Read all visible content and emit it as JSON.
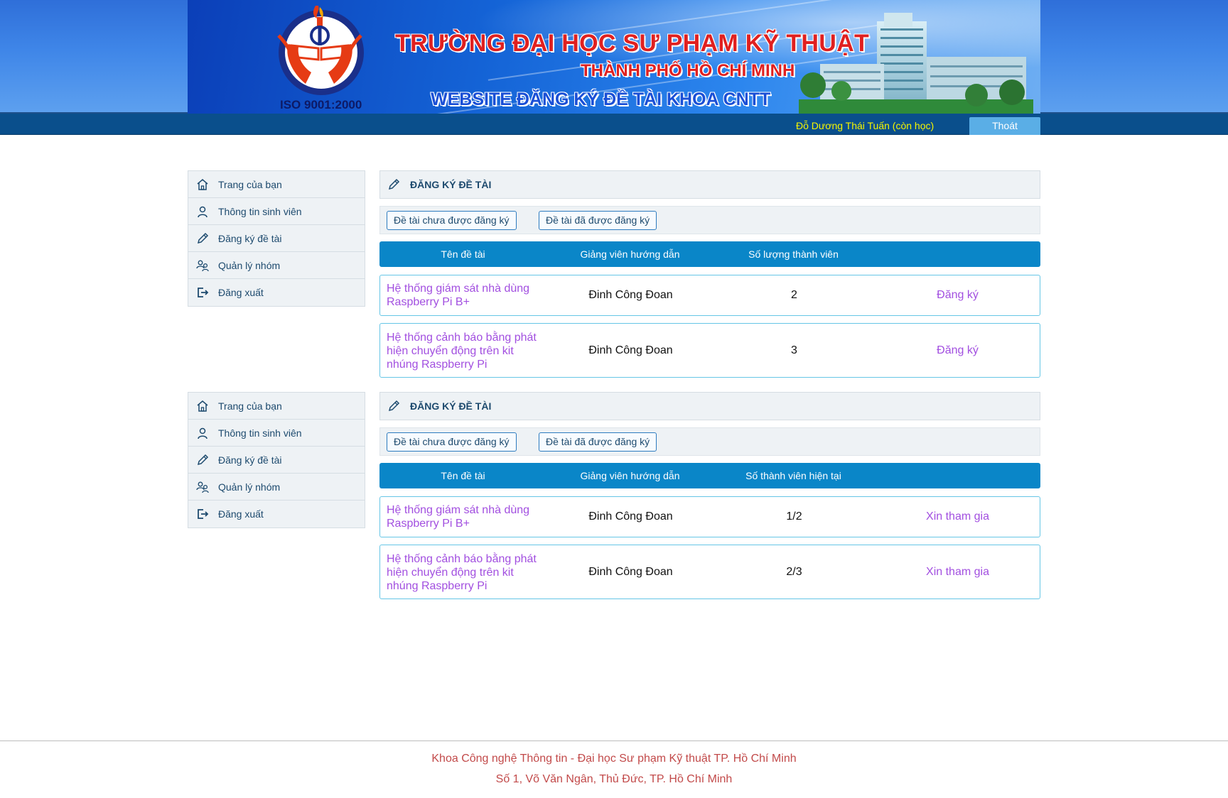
{
  "header": {
    "title_line1": "TRƯỜNG ĐẠI HỌC SƯ PHẠM KỸ THUẬT",
    "title_line2": "THÀNH PHỐ HỒ CHÍ MINH",
    "title_line3": "WEBSITE ĐĂNG KÝ ĐỀ TÀI KHOA CNTT",
    "iso": "ISO 9001:2000",
    "user_name": "Đỗ Dương Thái Tuấn (còn học)",
    "logout_label": "Thoát"
  },
  "sidebar": {
    "items": [
      {
        "label": "Trang của bạn",
        "icon": "home-icon"
      },
      {
        "label": "Thông tin sinh viên",
        "icon": "user-icon"
      },
      {
        "label": "Đăng ký đề tài",
        "icon": "pencil-icon"
      },
      {
        "label": "Quản lý nhóm",
        "icon": "users-icon"
      },
      {
        "label": "Đăng xuất",
        "icon": "logout-icon"
      }
    ]
  },
  "panels": [
    {
      "title": "ĐĂNG KÝ ĐỀ TÀI",
      "tabs": [
        "Đề tài chưa được đăng ký",
        "Đề tài đã được đăng ký"
      ],
      "columns": [
        "Tên đề tài",
        "Giảng viên hướng dẫn",
        "Số lượng thành viên"
      ],
      "rows": [
        {
          "topic": "Hệ thống giám sát nhà dùng Raspberry Pi B+",
          "lecturer": "Đinh Công Đoan",
          "members": "2",
          "action": "Đăng ký"
        },
        {
          "topic": " Hệ thống cảnh báo bằng phát hiện chuyển động trên kit nhúng Raspberry Pi",
          "lecturer": "Đinh Công Đoan",
          "members": "3",
          "action": "Đăng ký"
        }
      ]
    },
    {
      "title": "ĐĂNG KÝ ĐỀ TÀI",
      "tabs": [
        "Đề tài chưa được đăng ký",
        "Đề tài đã được đăng ký"
      ],
      "columns": [
        "Tên đề tài",
        "Giảng viên hướng dẫn",
        "Số thành viên hiện tại"
      ],
      "rows": [
        {
          "topic": "Hệ thống giám sát nhà dùng Raspberry Pi B+",
          "lecturer": "Đinh Công Đoan",
          "members": "1/2",
          "action": "Xin tham gia"
        },
        {
          "topic": " Hệ thống cảnh báo bằng phát hiện chuyển động trên kit nhúng Raspberry Pi",
          "lecturer": "Đinh Công Đoan",
          "members": "2/3",
          "action": "Xin tham gia"
        }
      ]
    }
  ],
  "footer": {
    "line1": "Khoa Công nghệ Thông tin - Đại học Sư phạm Kỹ thuật TP. Hồ Chí Minh",
    "line2": "Số 1, Võ Văn Ngân, Thủ Đức, TP. Hồ Chí Minh"
  },
  "colors": {
    "banner_blue": "#1463d6",
    "userbar": "#0a4f8c",
    "table_header": "#0a86c8",
    "link_purple": "#a24fe0",
    "footer_red": "#c24a4a"
  }
}
